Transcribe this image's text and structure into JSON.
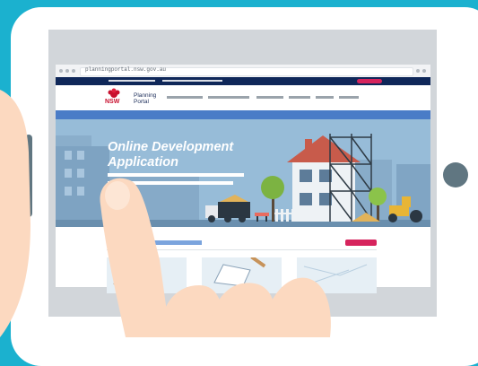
{
  "browser": {
    "url": "planningportal.nsw.gov.au"
  },
  "site": {
    "logo_text": "NSW",
    "logo_label_line1": "Planning",
    "logo_label_line2": "Portal"
  },
  "hero": {
    "title_line1": "Online Development",
    "title_line2": "Application"
  },
  "colors": {
    "background": "#1bb1cf",
    "navy": "#0f2759",
    "accent_pink": "#d6245d",
    "accent_blue": "#4a7cc7",
    "device_button": "#607681",
    "skin": "#fcd9c0"
  },
  "icons": [
    "nsw-waratah-logo-icon",
    "house-under-construction-illustration",
    "truck-icon",
    "roller-icon"
  ]
}
